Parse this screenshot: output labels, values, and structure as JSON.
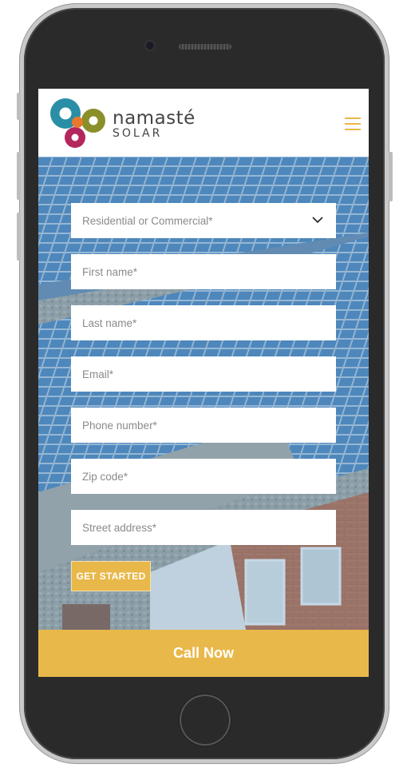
{
  "header": {
    "brand_line1": "namasté",
    "brand_line2": "SOLAR",
    "menu_icon": "hamburger-menu-icon"
  },
  "form": {
    "customer_type_placeholder": "Residential or Commercial*",
    "first_name_placeholder": "First name*",
    "last_name_placeholder": "Last name*",
    "email_placeholder": "Email*",
    "phone_placeholder": "Phone number*",
    "zip_placeholder": "Zip code*",
    "street_placeholder": "Street address*",
    "submit_label": "GET STARTED"
  },
  "call_bar": {
    "label": "Call Now"
  },
  "colors": {
    "accent": "#e9b84a",
    "logo_teal": "#2a8ea6",
    "logo_orange": "#e8782d",
    "logo_magenta": "#b3275d",
    "logo_olive": "#8b8f2a"
  }
}
